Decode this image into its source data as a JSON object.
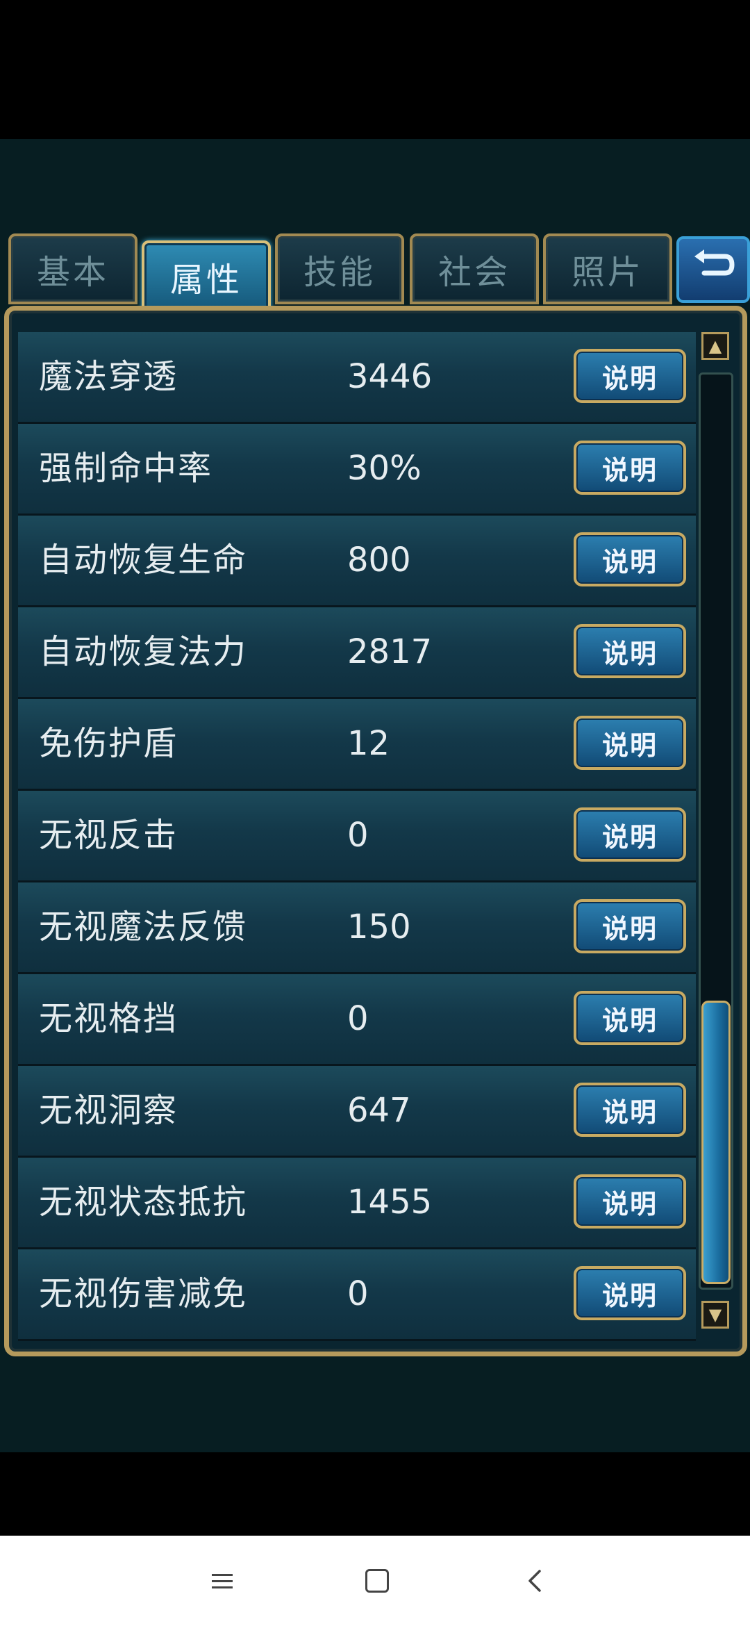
{
  "tabs": [
    {
      "label": "基本",
      "active": false
    },
    {
      "label": "属性",
      "active": true
    },
    {
      "label": "技能",
      "active": false
    },
    {
      "label": "社会",
      "active": false
    },
    {
      "label": "照片",
      "active": false
    }
  ],
  "back_icon": "return-arrow-icon",
  "rows": [
    {
      "name": "魔法穿透",
      "value": "3446",
      "button": "说明"
    },
    {
      "name": "强制命中率",
      "value": "30%",
      "button": "说明"
    },
    {
      "name": "自动恢复生命",
      "value": "800",
      "button": "说明"
    },
    {
      "name": "自动恢复法力",
      "value": "2817",
      "button": "说明"
    },
    {
      "name": "免伤护盾",
      "value": "12",
      "button": "说明"
    },
    {
      "name": "无视反击",
      "value": "0",
      "button": "说明"
    },
    {
      "name": "无视魔法反馈",
      "value": "150",
      "button": "说明"
    },
    {
      "name": "无视格挡",
      "value": "0",
      "button": "说明"
    },
    {
      "name": "无视洞察",
      "value": "647",
      "button": "说明"
    },
    {
      "name": "无视状态抵抗",
      "value": "1455",
      "button": "说明"
    },
    {
      "name": "无视伤害减免",
      "value": "0",
      "button": "说明"
    }
  ],
  "scrollbar": {
    "position": "bottom"
  },
  "navbar": {
    "icons": [
      "menu-icon",
      "home-icon",
      "back-icon"
    ]
  }
}
